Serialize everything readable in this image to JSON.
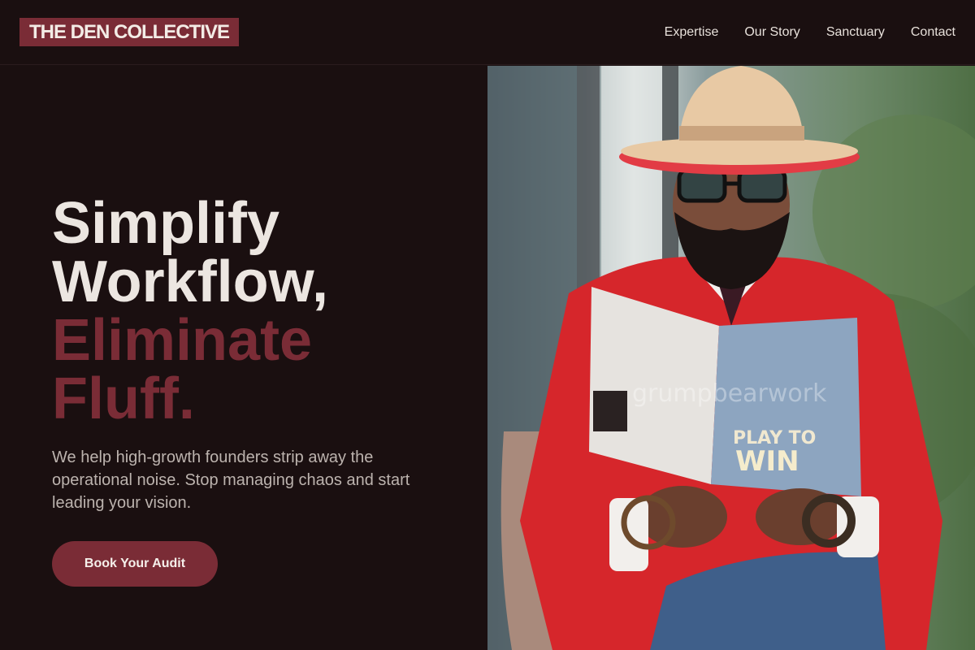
{
  "brand": {
    "name": "THE DEN COLLECTIVE"
  },
  "nav": {
    "items": [
      {
        "label": "Expertise"
      },
      {
        "label": "Our Story"
      },
      {
        "label": "Sanctuary"
      },
      {
        "label": "Contact"
      }
    ]
  },
  "hero": {
    "headline_line1": "Simplify",
    "headline_line2": "Workflow,",
    "accent_line1": "Eliminate",
    "accent_line2": "Fluff.",
    "subtext": "We help high-growth founders strip away the operational noise. Stop managing chaos and start leading your vision.",
    "cta_label": "Book Your Audit"
  },
  "image": {
    "watermark": "grumpbearwork",
    "book_title_line1": "PLAY TO",
    "book_title_line2": "WIN"
  },
  "colors": {
    "background": "#1a0f10",
    "accent": "#7a2c36",
    "text": "#ece6e1",
    "subtext": "#bcb3ae"
  }
}
